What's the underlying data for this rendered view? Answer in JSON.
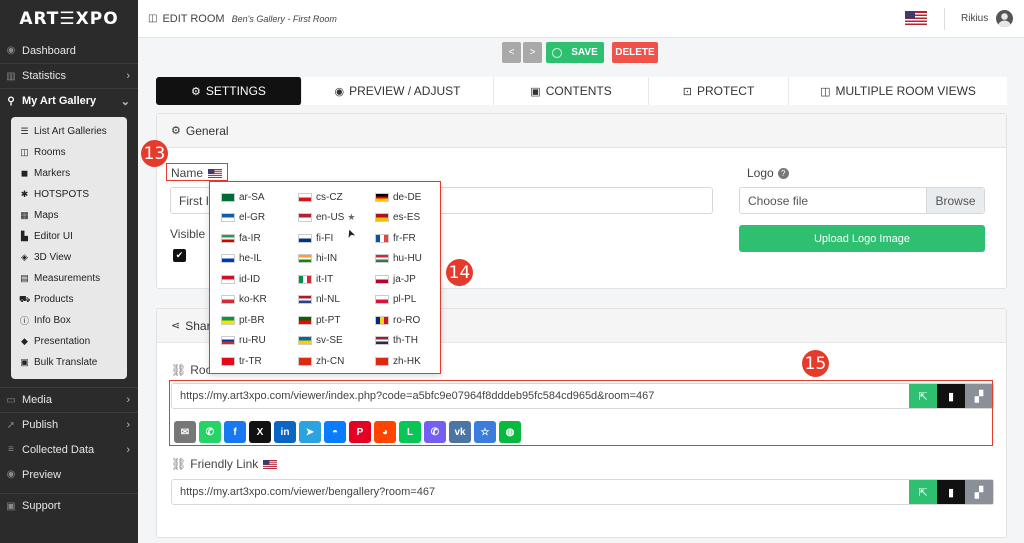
{
  "app": {
    "logo": "ART☰XPO"
  },
  "sidebar": {
    "top_items": [
      {
        "label": "Dashboard",
        "icon": "dashboard-icon"
      },
      {
        "label": "Statistics",
        "icon": "chart-icon"
      },
      {
        "label": "My Art Gallery",
        "icon": "gallery-icon"
      }
    ],
    "sub_items": [
      {
        "label": "List Art Galleries"
      },
      {
        "label": "Rooms"
      },
      {
        "label": "Markers"
      },
      {
        "label": "HOTSPOTS"
      },
      {
        "label": "Maps"
      },
      {
        "label": "Editor UI"
      },
      {
        "label": "3D View"
      },
      {
        "label": "Measurements"
      },
      {
        "label": "Products"
      },
      {
        "label": "Info Box"
      },
      {
        "label": "Presentation"
      },
      {
        "label": "Bulk Translate"
      }
    ],
    "bottom_items": [
      {
        "label": "Media"
      },
      {
        "label": "Publish"
      },
      {
        "label": "Collected Data"
      },
      {
        "label": "Preview"
      },
      {
        "label": "Support"
      }
    ]
  },
  "header": {
    "title": "EDIT ROOM",
    "breadcrumb": "Ben's Gallery - First Room",
    "username": "Rikius"
  },
  "toolbar": {
    "save_label": "SAVE",
    "delete_label": "DELETE",
    "prev": "<",
    "next": ">"
  },
  "tabs": [
    {
      "label": "SETTINGS",
      "icon": "⚙"
    },
    {
      "label": "PREVIEW / ADJUST",
      "icon": "👁"
    },
    {
      "label": "CONTENTS",
      "icon": "▣"
    },
    {
      "label": "PROTECT",
      "icon": "🔒"
    },
    {
      "label": "MULTIPLE ROOM VIEWS",
      "icon": "◫"
    }
  ],
  "general": {
    "heading": "General",
    "name_label": "Name",
    "name_value": "First I",
    "visible_label": "Visible",
    "logo_label": "Logo",
    "choose_file": "Choose file",
    "browse": "Browse",
    "upload_logo": "Upload Logo Image"
  },
  "share": {
    "heading": "Shar",
    "room_label": "Roo",
    "room_url": "https://my.art3xpo.com/viewer/index.php?code=a5bfc9e07964f8dddeb95fc584cd965d&room=467",
    "friendly_label": "Friendly Link",
    "friendly_url": "https://my.art3xpo.com/viewer/bengallery?room=467"
  },
  "languages": [
    "ar-SA",
    "cs-CZ",
    "de-DE",
    "el-GR",
    "en-US",
    "es-ES",
    "fa-IR",
    "fi-FI",
    "fr-FR",
    "he-IL",
    "hi-IN",
    "hu-HU",
    "id-ID",
    "it-IT",
    "ja-JP",
    "ko-KR",
    "nl-NL",
    "pl-PL",
    "pt-BR",
    "pt-PT",
    "ro-RO",
    "ru-RU",
    "sv-SE",
    "th-TH",
    "tr-TR",
    "zh-CN",
    "zh-HK"
  ],
  "markers": [
    "13",
    "14",
    "15"
  ],
  "colors": {
    "accent_green": "#2fbf71",
    "danger": "#f0524b",
    "annotation": "#e43b2c",
    "sidebar": "#2b2b2b"
  }
}
